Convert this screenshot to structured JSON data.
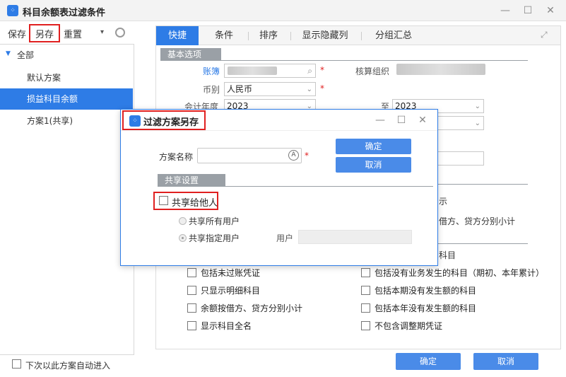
{
  "window": {
    "title": "科目余额表过滤条件"
  },
  "toolbar": {
    "save": "保存",
    "save_as": "另存",
    "reset": "重置"
  },
  "tree": {
    "root": "全部",
    "items": [
      "默认方案",
      "损益科目余额",
      "方案1(共享)"
    ],
    "selected_index": 1
  },
  "auto_enter": {
    "label": "下次以此方案自动进入"
  },
  "tabs": [
    "快捷",
    "条件",
    "排序",
    "显示隐藏列",
    "分组汇总"
  ],
  "basic": {
    "header": "基本选项",
    "ledger_label": "账簿",
    "org_label": "核算组织",
    "currency_label": "币别",
    "currency_value": "人民币",
    "year_label": "会计年度",
    "year_from": "2023",
    "to_label": "至",
    "year_to": "2023"
  },
  "options": {
    "partial_right_1": "示",
    "partial_right_2": "借方、贷方分别小计",
    "partial_right_3": "科目",
    "left": [
      "包括未过账凭证",
      "只显示明细科目",
      "余额按借方、贷方分别小计",
      "显示科目全名"
    ],
    "right": [
      "包括没有业务发生的科目（期初、本年累计）",
      "包括本期没有发生额的科目",
      "包括本年没有发生额的科目",
      "不包含调整期凭证"
    ]
  },
  "footer": {
    "ok": "确定",
    "cancel": "取消"
  },
  "dialog": {
    "title": "过滤方案另存",
    "name_label": "方案名称",
    "name_value": "",
    "ok": "确定",
    "cancel": "取消",
    "share_header": "共享设置",
    "share_checkbox": "共享给他人",
    "share_all": "共享所有用户",
    "share_specific": "共享指定用户",
    "user_label": "用户"
  },
  "colors": {
    "accent": "#2e7ce6",
    "highlight": "#e02020",
    "section": "#9aa0a6"
  }
}
